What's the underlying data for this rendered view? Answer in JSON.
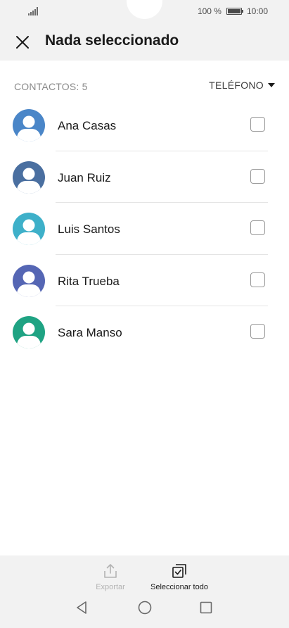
{
  "status_bar": {
    "battery_text": "100 %",
    "time": "10:00",
    "battery_level": 1.0,
    "icons": [
      "signal-icon",
      "battery-icon"
    ]
  },
  "app_bar": {
    "title": "Nada seleccionado",
    "close_icon": "close-icon"
  },
  "list_header": {
    "count_label": "CONTACTOS: 5",
    "filter_label": "TELÉFONO",
    "filter_icon": "caret-down-icon"
  },
  "contacts": [
    {
      "name": "Ana Casas",
      "avatar_color": "#4a86c8",
      "checked": false
    },
    {
      "name": "Juan Ruiz",
      "avatar_color": "#4a6fa0",
      "checked": false
    },
    {
      "name": "Luis Santos",
      "avatar_color": "#3eb0c9",
      "checked": false
    },
    {
      "name": "Rita Trueba",
      "avatar_color": "#5566b4",
      "checked": false
    },
    {
      "name": "Sara Manso",
      "avatar_color": "#1fa383",
      "checked": false
    }
  ],
  "bottom_actions": {
    "export_label": "Exportar",
    "export_icon": "export-icon",
    "select_all_label": "Seleccionar todo",
    "select_all_icon": "select-all-icon"
  },
  "nav_bar": {
    "icons": [
      "back-icon",
      "home-icon",
      "recents-icon"
    ]
  },
  "colors": {
    "bar_background": "#f2f2f2",
    "text_primary": "#1a1a1a",
    "text_secondary": "#8a8a8a",
    "disabled": "#b3b3b3"
  }
}
